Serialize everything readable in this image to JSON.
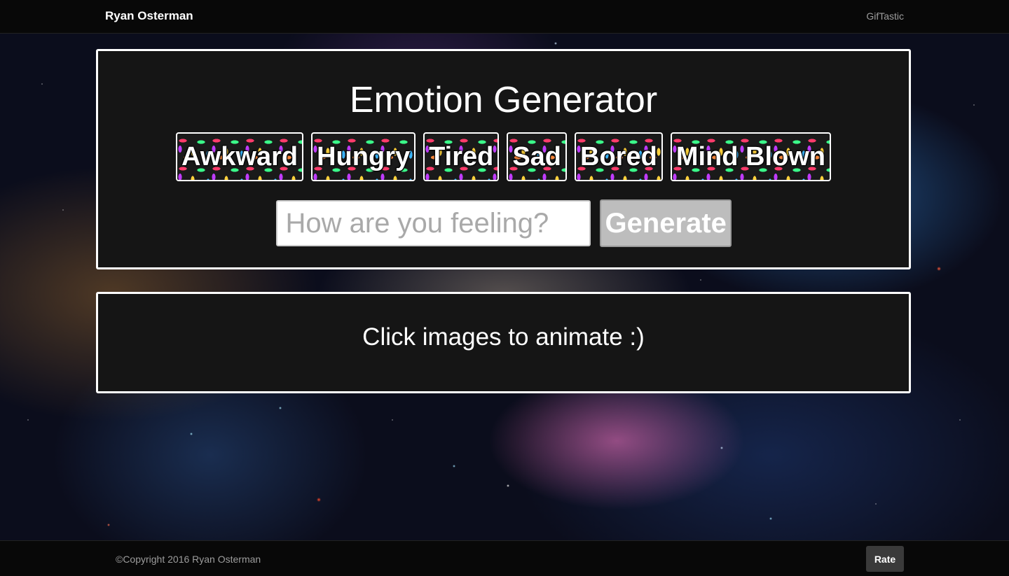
{
  "navbar": {
    "brand": "Ryan Osterman",
    "link": "GifTastic"
  },
  "main": {
    "title": "Emotion Generator",
    "emotions": [
      "Awkward",
      "Hungry",
      "Tired",
      "Sad",
      "Bored",
      "Mind Blown"
    ],
    "search": {
      "value": "",
      "placeholder": "How are you feeling?"
    },
    "generate_label": "Generate"
  },
  "results": {
    "hint": "Click images to animate :)"
  },
  "footer": {
    "copyright": "©Copyright 2016 Ryan Osterman",
    "rate_label": "Rate"
  },
  "colors": {
    "panel_bg": "#151515",
    "panel_border": "#ffffff",
    "navbar_bg": "#080808",
    "generate_bg": "#bdbdbd",
    "rate_bg": "#3a3a3a"
  }
}
